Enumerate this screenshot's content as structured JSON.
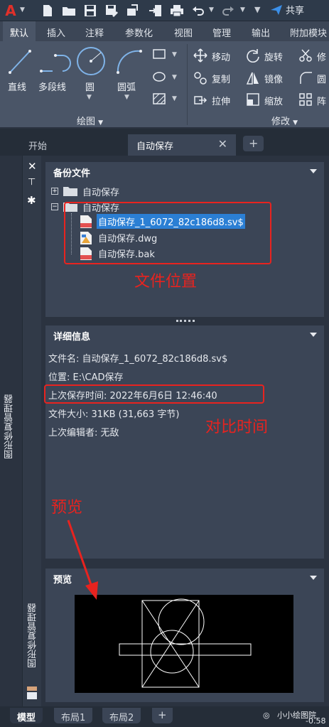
{
  "titlebar": {
    "app_letter": "A",
    "share_label": "共享"
  },
  "ribbon_tabs": [
    "默认",
    "插入",
    "注释",
    "参数化",
    "视图",
    "管理",
    "输出",
    "附加模块"
  ],
  "ribbon": {
    "draw_panel": {
      "tools": [
        "直线",
        "多段线",
        "圆",
        "圆弧"
      ],
      "footer": "绘图"
    },
    "modify_panel": {
      "tools": [
        "移动",
        "旋转",
        "修",
        "复制",
        "镜像",
        "圆",
        "拉伸",
        "缩放",
        "阵"
      ],
      "footer": "修改"
    }
  },
  "file_tabs": {
    "start": "开始",
    "active": "自动保存"
  },
  "palette": {
    "vertical_title": "图形修复管理器",
    "backup": {
      "header": "备份文件",
      "tree": [
        {
          "label": "自动保存",
          "level": 0,
          "expanded": false
        },
        {
          "label": "自动保存",
          "level": 0,
          "expanded": true
        },
        {
          "label": "自动保存_1_6072_82c186d8.sv$",
          "level": 1,
          "selected": true,
          "icon": "sv-file-icon"
        },
        {
          "label": "自动保存.dwg",
          "level": 1,
          "selected": false,
          "icon": "dwg-file-icon"
        },
        {
          "label": "自动保存.bak",
          "level": 1,
          "selected": false,
          "icon": "bak-file-icon"
        }
      ]
    },
    "details": {
      "header": "详细信息",
      "rows": [
        "文件名: 自动保存_1_6072_82c186d8.sv$",
        "位置: E:\\CAD保存",
        "上次保存时间: 2022年6月6日  12:46:40",
        "文件大小: 31KB (31,663 字节)",
        "上次编辑者: 无敌"
      ]
    },
    "preview": {
      "header": "预览"
    }
  },
  "annotations": {
    "file_location": "文件位置",
    "compare_time": "对比时间",
    "preview": "预览"
  },
  "layout_tabs": [
    "模型",
    "布局1",
    "布局2"
  ],
  "status": {
    "watermark": "小小绘图院",
    "coord": "-0.58"
  },
  "colors": {
    "accent_red": "#e8231f",
    "selection_blue": "#2b7fd4",
    "share_blue": "#3b8fe8"
  }
}
